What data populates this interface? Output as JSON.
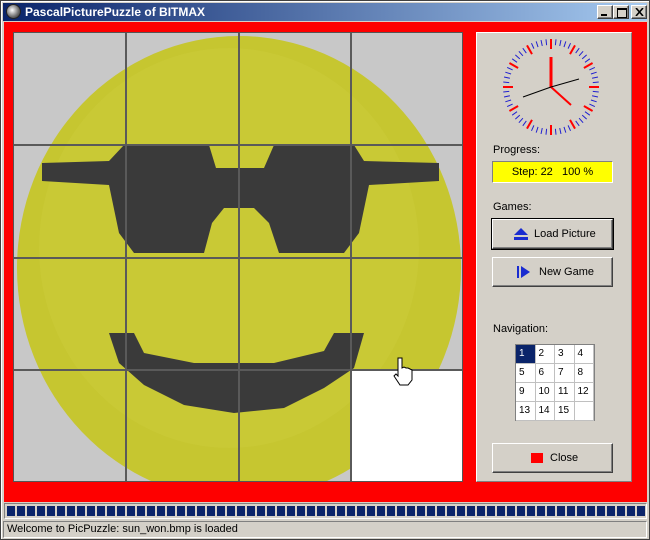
{
  "window": {
    "title": "PascalPicturePuzzle of BITMAX"
  },
  "side_panel": {
    "progress_label": "Progress:",
    "progress_value": "Step: 22   100 %",
    "games_label": "Games:",
    "load_picture_label": "Load Picture",
    "new_game_label": "New Game",
    "navigation_label": "Navigation:",
    "nav_cells": [
      "1",
      "2",
      "3",
      "4",
      "5",
      "6",
      "7",
      "8",
      "9",
      "10",
      "11",
      "12",
      "13",
      "14",
      "15",
      ""
    ],
    "close_label": "Close"
  },
  "status": {
    "message": "Welcome to PicPuzzle: sun_won.bmp is loaded"
  },
  "colors": {
    "frame": "#fe0000",
    "progress_box": "#ffff00",
    "accent": "#0a246a",
    "smiley": "#c6c630",
    "glasses": "#3a3a3a"
  },
  "icons": {
    "load": "eject-icon",
    "new_game": "play-next-icon",
    "close": "red-square-icon"
  }
}
